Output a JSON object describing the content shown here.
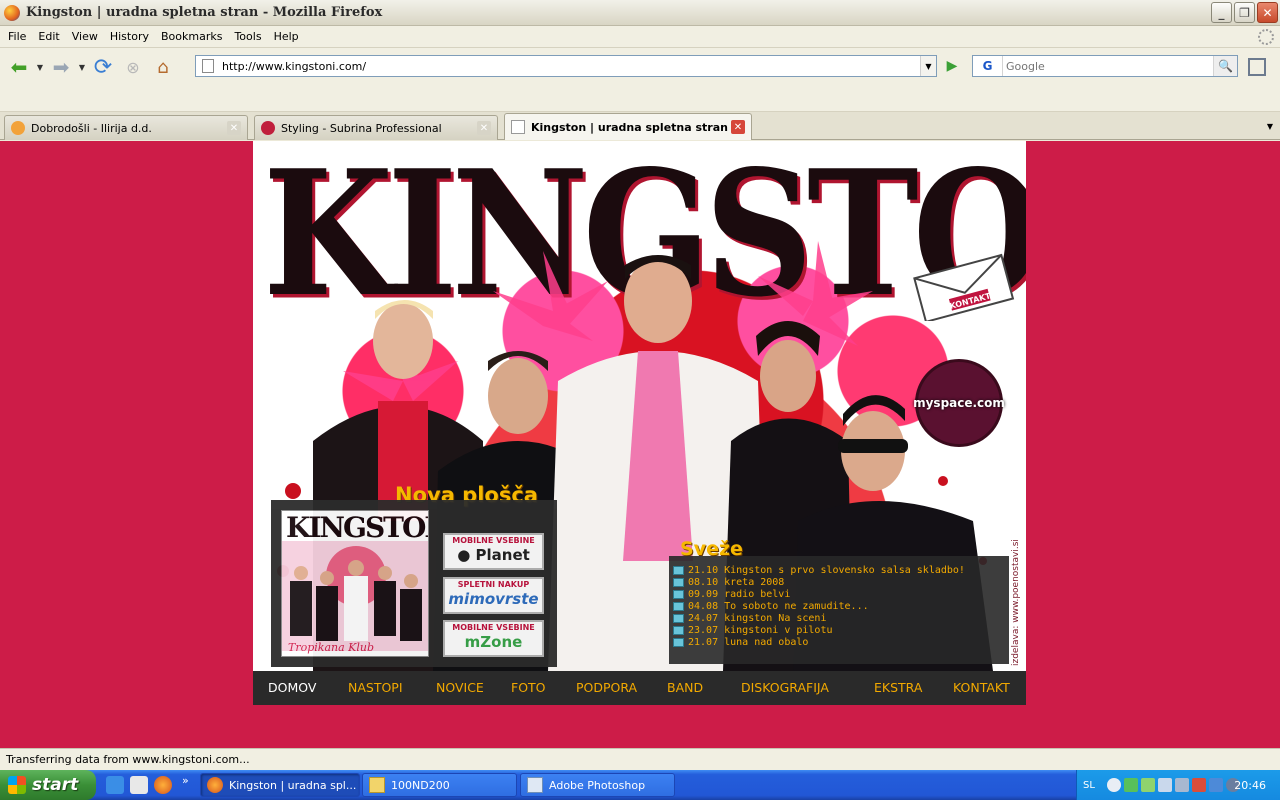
{
  "window": {
    "title": "Kingston  |  uradna spletna stran - Mozilla Firefox"
  },
  "menubar": {
    "items": [
      "File",
      "Edit",
      "View",
      "History",
      "Bookmarks",
      "Tools",
      "Help"
    ]
  },
  "navbar": {
    "url": "http://www.kingstoni.com/",
    "search_placeholder": "Google",
    "search_engine": "G"
  },
  "tabs": [
    {
      "label": "Dobrodošli - Ilirija d.d.",
      "active": false
    },
    {
      "label": "Styling - Subrina Professional",
      "active": false
    },
    {
      "label": "Kingston  |  uradna spletna stran",
      "active": true
    }
  ],
  "site": {
    "logo": "KINGSTON",
    "contact_badge": "KONTAKT",
    "myspace_badge": "myspace.com",
    "credit": "izdelava: www.poenostavi.si",
    "nova_plosca_title": "Nova plošča",
    "album": {
      "title": "KINGSTON",
      "subtitle": "Tropikana Klub"
    },
    "promos": [
      {
        "top": "MOBILNE VSEBINE",
        "main": "● Planet"
      },
      {
        "top": "SPLETNI NAKUP",
        "main": "mimovrste"
      },
      {
        "top": "MOBILNE VSEBINE",
        "main": "mZone"
      }
    ],
    "sveze_title": "Sveže",
    "news": [
      "21.10 Kingston s prvo slovensko salsa skladbo!",
      "08.10 kreta 2008",
      "09.09 radio belvi",
      "04.08 To soboto ne zamudite...",
      "24.07 kingston Na sceni",
      "23.07 kingstoni v pilotu",
      "21.07 luna nad obalo"
    ],
    "nav": [
      "DOMOV",
      "NASTOPI",
      "NOVICE",
      "FOTO",
      "PODPORA",
      "BAND",
      "DISKOGRAFIJA",
      "EKSTRA",
      "KONTAKT"
    ],
    "nav_active": "DOMOV"
  },
  "statusbar": {
    "text": "Transferring data from www.kingstoni.com..."
  },
  "taskbar": {
    "start_label": "start",
    "tasks": [
      "Kingston | uradna spl...",
      "100ND200",
      "Adobe Photoshop"
    ],
    "language": "SL",
    "clock": "20:46"
  },
  "colors": {
    "page_background": "#cd1c48",
    "nav_text": "#f2a900",
    "heading_gold": "#f6b800",
    "xp_blue": "#245edb"
  }
}
